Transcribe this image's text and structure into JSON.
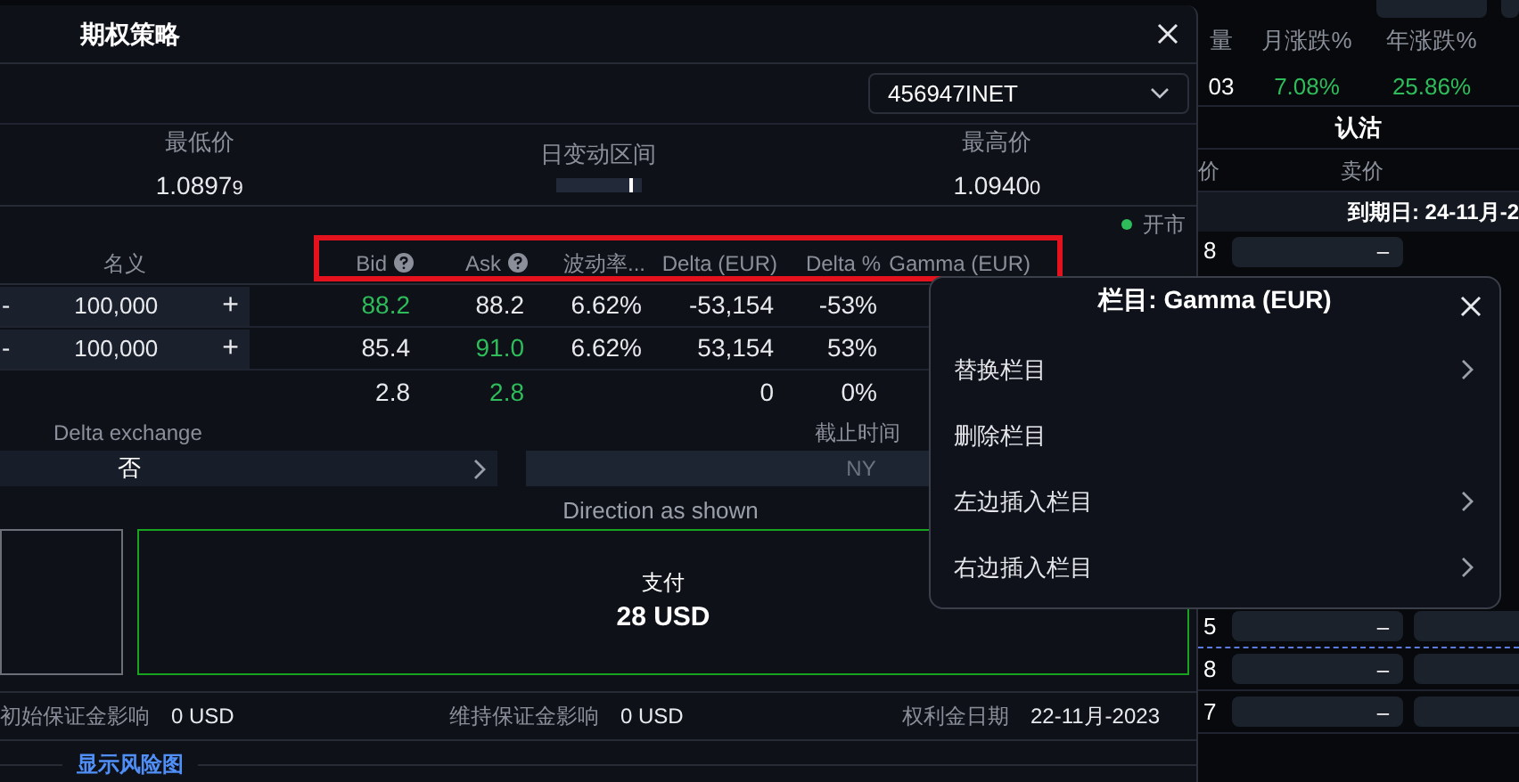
{
  "dialog": {
    "title": "期权策略",
    "account": "456947INET",
    "stats": [
      {
        "kind": "price",
        "label": "最低价",
        "value": "1.0897",
        "small_digit": "9"
      },
      {
        "kind": "range",
        "label": "日变动区间",
        "level": 0.87
      },
      {
        "kind": "price",
        "label": "最高价",
        "value": "1.0940",
        "small_digit": "0"
      }
    ],
    "market_status": {
      "label": "开市",
      "open": true
    },
    "table": {
      "highlighted_headers": true,
      "columns": [
        {
          "label": "名义",
          "help": false
        },
        {
          "label": "Bid",
          "help": true
        },
        {
          "label": "Ask",
          "help": true
        },
        {
          "label": "波动率...",
          "help": false
        },
        {
          "label": "Delta (EUR)",
          "help": false
        },
        {
          "label": "Delta %",
          "help": false
        },
        {
          "label": "Gamma (EUR)",
          "help": false
        }
      ],
      "rows": [
        {
          "decrement": "-",
          "notional": "100,000",
          "increment": "+",
          "bid": {
            "text": "88.2",
            "green": true
          },
          "ask": {
            "text": "88.2",
            "green": false
          },
          "vol": {
            "text": "6.62%",
            "green": false
          },
          "delta": {
            "text": "-53,154",
            "green": false
          },
          "delta_pct": {
            "text": "-53%",
            "green": false
          }
        },
        {
          "decrement": "-",
          "notional": "100,000",
          "increment": "+",
          "bid": {
            "text": "85.4",
            "green": false
          },
          "ask": {
            "text": "91.0",
            "green": true
          },
          "vol": {
            "text": "6.62%",
            "green": false
          },
          "delta": {
            "text": "53,154",
            "green": false
          },
          "delta_pct": {
            "text": "53%",
            "green": false
          }
        }
      ],
      "totals": {
        "bid": {
          "text": "2.8",
          "green": false
        },
        "ask": {
          "text": "2.8",
          "green": true
        },
        "delta": {
          "text": "0",
          "green": false
        },
        "delta_pct": {
          "text": "0%",
          "green": false
        }
      }
    },
    "delta_exchange": {
      "label": "Delta exchange",
      "value": "否"
    },
    "cutoff": {
      "label": "截止时间",
      "value": "NY",
      "disabled": true
    },
    "direction_note": "Direction as shown",
    "payment": {
      "label": "支付",
      "amount": "28 USD"
    },
    "margins": [
      {
        "label": "初始保证金影响",
        "value": "0 USD"
      },
      {
        "label": "维持保证金影响",
        "value": "0 USD"
      },
      {
        "label": "权利金日期",
        "value": "22-11月-2023"
      }
    ],
    "risk_link": "显示风险图"
  },
  "column_menu": {
    "title": "栏目: Gamma (EUR)",
    "items": [
      {
        "label": "替换栏目",
        "submenu": true
      },
      {
        "label": "删除栏目",
        "submenu": false
      },
      {
        "label": "左边插入栏目",
        "submenu": true
      },
      {
        "label": "右边插入栏目",
        "submenu": true
      }
    ]
  },
  "background": {
    "stats": [
      {
        "label": "量",
        "value": "03"
      },
      {
        "label": "月涨跌%",
        "value": "7.08%"
      },
      {
        "label": "年涨跌%",
        "value": "25.86%"
      }
    ],
    "put_label": "认沽",
    "price_headers": [
      "价",
      "卖价"
    ],
    "expiry": "到期日: 24-11月-2",
    "top_rows": [
      {
        "strike": "8",
        "bid": "–"
      }
    ],
    "bottom_rows": [
      {
        "strike": "5",
        "bid": "–"
      },
      {
        "strike": "8",
        "bid": "–"
      },
      {
        "strike": "7",
        "bid": "–"
      }
    ]
  }
}
